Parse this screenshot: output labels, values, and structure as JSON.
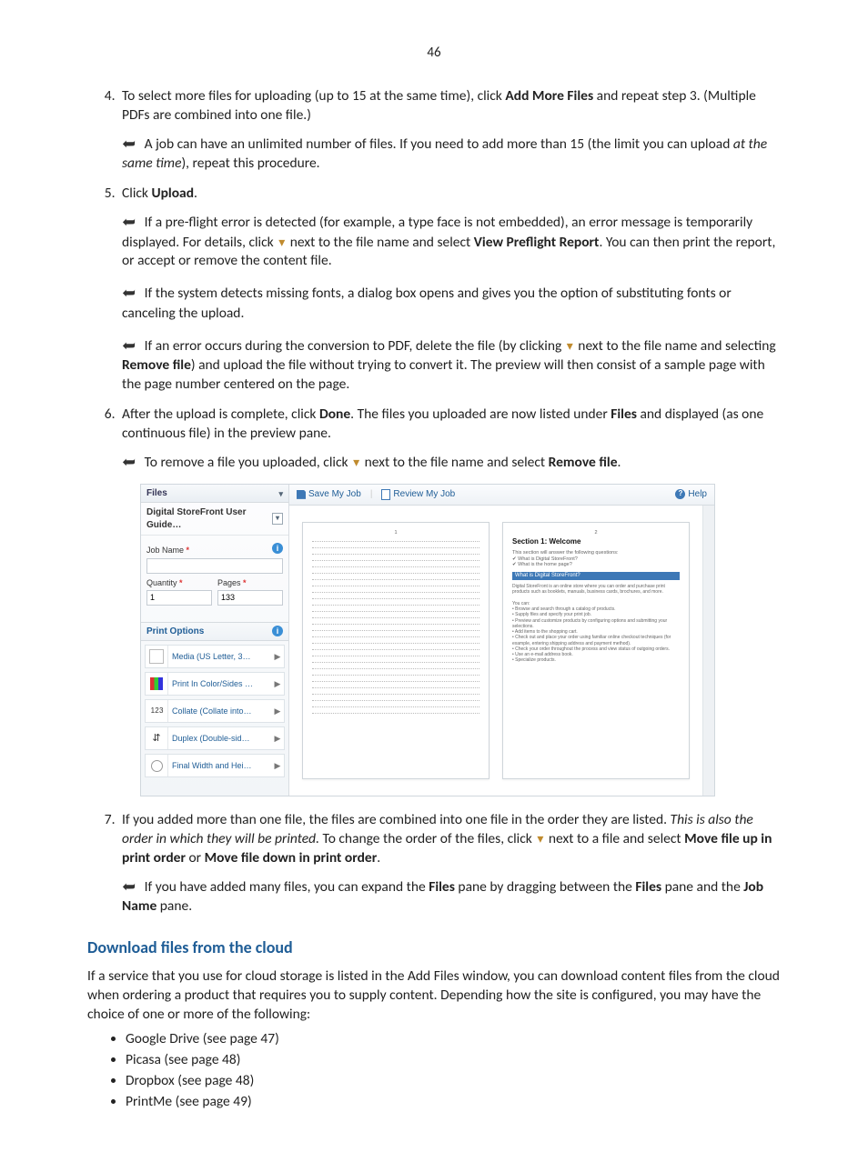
{
  "page_number": "46",
  "steps": {
    "s4": {
      "text_a": "To select more files for uploading (up to 15 at the same time), click ",
      "bold_a": "Add More Files",
      "text_b": " and repeat step 3. (Multiple PDFs are combined into one file.)",
      "note": {
        "a": "A job can have an unlimited number of files. If you need to add more than 15 (the limit you can upload ",
        "i": "at the same time",
        "b": "), repeat this procedure."
      }
    },
    "s5": {
      "lead_a": "Click ",
      "lead_bold": "Upload",
      "lead_b": ".",
      "n1_a": "If a pre-flight error is detected (for example, a type face is not embedded), an error message is temporarily displayed. For details, click ",
      "n1_b": " next to the file name and select ",
      "n1_bold": "View Preflight Report",
      "n1_c": ". You can then print the report, or accept or remove the content file.",
      "n2": "If the system detects missing fonts, a dialog box opens and gives you the option of substituting fonts or canceling the upload.",
      "n3_a": "If an error occurs during the conversion to PDF, delete the file (by clicking ",
      "n3_b": " next to the file name and selecting ",
      "n3_bold": "Remove file",
      "n3_c": ") and upload the file without trying to convert it. The preview will then consist of a sample page with the page number centered on the page."
    },
    "s6": {
      "a": "After the upload is complete, click ",
      "bold1": "Done",
      "b": ". The files you uploaded are now listed under ",
      "bold2": "Files",
      "c": " and displayed (as one continuous file) in the preview pane.",
      "note_a": "To remove a file you uploaded, click ",
      "note_b": " next to the file name and select ",
      "note_bold": "Remove file",
      "note_c": "."
    },
    "s7": {
      "a": "If you added more than one file, the files are combined into one file in the order they are listed. ",
      "i": "This is also the order in which they will be printed.",
      "b": " To change the order of the files, click ",
      "c": " next to a file and select ",
      "bold1": "Move file up in print order",
      "d": " or ",
      "bold2": "Move file down in print order",
      "e": ".",
      "note_a": "If you have added many files, you can expand the ",
      "note_b1": "Files",
      "note_c": " pane by dragging between the ",
      "note_b2": "Files",
      "note_d": " pane and the ",
      "note_b3": "Job Name",
      "note_e": " pane."
    }
  },
  "section_heading": "Download files from the cloud",
  "section_body": "If a service that you use for cloud storage is listed in the Add Files window, you can download content files from the cloud when ordering a product that requires you to supply content. Depending how the site is configured, you may have the choice of one or more of the following:",
  "cloud_list": [
    "Google Drive (see page 47)",
    "Picasa (see page 48)",
    "Dropbox (see page 48)",
    "PrintMe (see page 49)"
  ],
  "app": {
    "files_header": "Files",
    "file_name": "Digital StoreFront User Guide…",
    "job_name_label": "Job Name",
    "quantity_label": "Quantity",
    "pages_label": "Pages",
    "quantity_value": "1",
    "pages_value": "133",
    "print_options": "Print Options",
    "po": [
      "Media (US Letter, 3…",
      "Print In Color/Sides …",
      "Collate (Collate into…",
      "Duplex (Double-sid…",
      "Final Width and Hei…"
    ],
    "save": "Save My Job",
    "review": "Review My Job",
    "help": "Help",
    "preview_title": "Section 1: Welcome",
    "preview_bar": "What is Digital StoreFront?"
  }
}
